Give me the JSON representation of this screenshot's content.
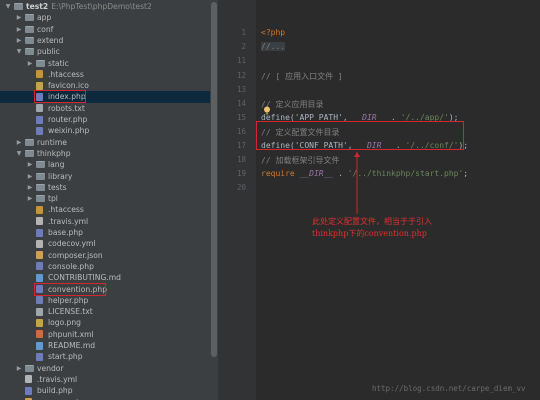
{
  "project_root": {
    "name": "test2",
    "path": "E:\\PhpTest\\phpDemo\\test2"
  },
  "tree": [
    {
      "label": "test2",
      "indent": 0,
      "type": "folder",
      "expanded": true,
      "root": true
    },
    {
      "label": "app",
      "indent": 1,
      "type": "folder",
      "expanded": false
    },
    {
      "label": "conf",
      "indent": 1,
      "type": "folder",
      "expanded": false
    },
    {
      "label": "extend",
      "indent": 1,
      "type": "folder",
      "expanded": false
    },
    {
      "label": "public",
      "indent": 1,
      "type": "folder",
      "expanded": true
    },
    {
      "label": "static",
      "indent": 2,
      "type": "folder",
      "expanded": false
    },
    {
      "label": ".htaccess",
      "indent": 2,
      "type": "ht"
    },
    {
      "label": "favicon.ico",
      "indent": 2,
      "type": "img"
    },
    {
      "label": "index.php",
      "indent": 2,
      "type": "php",
      "selected": true,
      "boxed": true
    },
    {
      "label": "robots.txt",
      "indent": 2,
      "type": "txt"
    },
    {
      "label": "router.php",
      "indent": 2,
      "type": "php"
    },
    {
      "label": "weixin.php",
      "indent": 2,
      "type": "php"
    },
    {
      "label": "runtime",
      "indent": 1,
      "type": "folder",
      "expanded": false
    },
    {
      "label": "thinkphp",
      "indent": 1,
      "type": "folder",
      "expanded": true
    },
    {
      "label": "lang",
      "indent": 2,
      "type": "folder",
      "expanded": false
    },
    {
      "label": "library",
      "indent": 2,
      "type": "folder",
      "expanded": false
    },
    {
      "label": "tests",
      "indent": 2,
      "type": "folder",
      "expanded": false
    },
    {
      "label": "tpl",
      "indent": 2,
      "type": "folder",
      "expanded": false
    },
    {
      "label": ".htaccess",
      "indent": 2,
      "type": "ht"
    },
    {
      "label": ".travis.yml",
      "indent": 2,
      "type": "yml"
    },
    {
      "label": "base.php",
      "indent": 2,
      "type": "php"
    },
    {
      "label": "codecov.yml",
      "indent": 2,
      "type": "yml"
    },
    {
      "label": "composer.json",
      "indent": 2,
      "type": "json"
    },
    {
      "label": "console.php",
      "indent": 2,
      "type": "php"
    },
    {
      "label": "CONTRIBUTING.md",
      "indent": 2,
      "type": "md"
    },
    {
      "label": "convention.php",
      "indent": 2,
      "type": "php",
      "boxed": true
    },
    {
      "label": "helper.php",
      "indent": 2,
      "type": "php"
    },
    {
      "label": "LICENSE.txt",
      "indent": 2,
      "type": "txt"
    },
    {
      "label": "logo.png",
      "indent": 2,
      "type": "img"
    },
    {
      "label": "phpunit.xml",
      "indent": 2,
      "type": "xml"
    },
    {
      "label": "README.md",
      "indent": 2,
      "type": "md"
    },
    {
      "label": "start.php",
      "indent": 2,
      "type": "php"
    },
    {
      "label": "vendor",
      "indent": 1,
      "type": "folder",
      "expanded": false
    },
    {
      "label": ".travis.yml",
      "indent": 1,
      "type": "yml"
    },
    {
      "label": "build.php",
      "indent": 1,
      "type": "php"
    },
    {
      "label": "composer.json",
      "indent": 1,
      "type": "json"
    }
  ],
  "editor": {
    "lines": [
      {
        "n": "1",
        "tokens": [
          {
            "t": "<?php",
            "c": "kw"
          }
        ]
      },
      {
        "n": "2",
        "tokens": [
          {
            "t": "//...",
            "c": "fold-mark"
          }
        ]
      },
      {
        "n": "11",
        "tokens": []
      },
      {
        "n": "12",
        "tokens": [
          {
            "t": "// [ 应用入口文件 ]",
            "c": "cmt"
          }
        ]
      },
      {
        "n": "13",
        "tokens": []
      },
      {
        "n": "14",
        "tokens": [
          {
            "t": "// 定义应用目录",
            "c": "cmt"
          }
        ]
      },
      {
        "n": "15",
        "tokens": [
          {
            "t": "define('APP_PATH', ",
            "c": ""
          },
          {
            "t": "__DIR__",
            "c": "const"
          },
          {
            "t": " . ",
            "c": ""
          },
          {
            "t": "'/../app/'",
            "c": "str"
          },
          {
            "t": ");",
            "c": ""
          }
        ]
      },
      {
        "n": "16",
        "tokens": [
          {
            "t": "// 定义配置文件目录",
            "c": "cmt"
          }
        ]
      },
      {
        "n": "17",
        "tokens": [
          {
            "t": "define('CONF_PATH', ",
            "c": ""
          },
          {
            "t": "__DIR__",
            "c": "const"
          },
          {
            "t": " . ",
            "c": ""
          },
          {
            "t": "'/../conf/'",
            "c": "str"
          },
          {
            "t": ");",
            "c": ""
          }
        ]
      },
      {
        "n": "18",
        "tokens": [
          {
            "t": "// 加载框架引导文件",
            "c": "cmt"
          }
        ]
      },
      {
        "n": "19",
        "tokens": [
          {
            "t": "require ",
            "c": "kw"
          },
          {
            "t": "__DIR__",
            "c": "const"
          },
          {
            "t": " . ",
            "c": ""
          },
          {
            "t": "'/../thinkphp/start.php'",
            "c": "str"
          },
          {
            "t": ";",
            "c": ""
          }
        ]
      },
      {
        "n": "20",
        "tokens": []
      }
    ]
  },
  "annotation": {
    "line1": "此处定义配置文件，相当于于引入",
    "line2": "thinkphp下的convention.php"
  },
  "watermark": "http://blog.csdn.net/carpe_diem_vv",
  "colors": {
    "highlight_box": "#d3262e",
    "selection": "#0d293e"
  }
}
